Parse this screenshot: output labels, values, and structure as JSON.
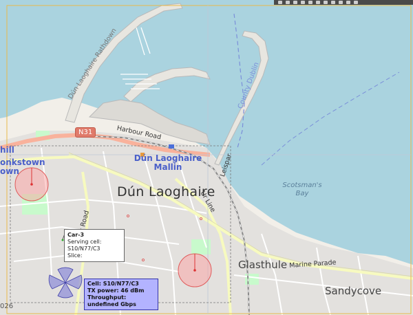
{
  "map": {
    "places": {
      "dun_laoghaire": "Dún Laoghaire",
      "glasthule": "Glasthule",
      "sandycove": "Sandycove",
      "monkstown_a": "hill",
      "monkstown_b": "onkstown",
      "monkstown_c": "own",
      "mallin_a": "Dún Laoghaire",
      "mallin_b": "Mallin",
      "scotsmans_bay_a": "Scotsman's",
      "scotsmans_bay_b": "Bay",
      "county_dublin": "County Dublin",
      "copyright_fragment": "026"
    },
    "roads": {
      "harbour_road": "Harbour Road",
      "marine_parade": "Marine Parade",
      "pier_rathdown": "Dún Laoghaire Rathdown",
      "park_road": "rk Road",
      "line_road": "Ur Line",
      "leispar": "Leispar"
    },
    "shield": "N31",
    "colors": {
      "water": "#aad3df",
      "land": "#f2efe9",
      "urban": "#e0dfdf",
      "major_road": "#f9b29c",
      "secondary_road": "#f7fabf",
      "cell_fill": "#ff9b9b",
      "sector_fill": "#8c8cd9"
    }
  },
  "car_popup": {
    "title": "Car-3",
    "serving_cell": "Serving cell: S10/N77/C3",
    "slice": "Slice:"
  },
  "cell_popup": {
    "cell": "Cell: S10/N77/C3",
    "tx_power": "TX power: 46 dBm",
    "throughput": "Throughput: undefined Gbps"
  },
  "toolbar": {
    "icons": [
      "camera-icon",
      "zoom-in-icon",
      "pan-icon",
      "box-select-icon",
      "lasso-icon",
      "zoom-out-icon",
      "autoscale-icon",
      "reset-icon",
      "spike-icon",
      "compare-icon",
      "plotly-logo-icon"
    ]
  }
}
